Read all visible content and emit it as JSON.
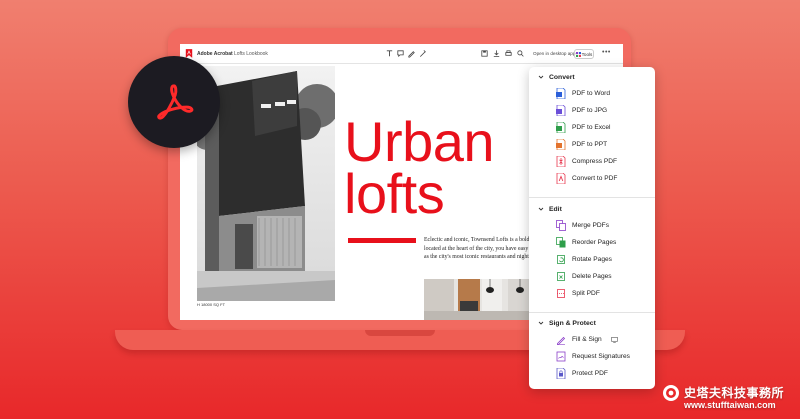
{
  "app": {
    "name": "Adobe Acrobat",
    "document_name": "Lofts Lookbook",
    "open_desktop_label": "Open in desktop app",
    "tools_label": "Tools",
    "more_label": "•••"
  },
  "document": {
    "headline_line1": "Urban",
    "headline_line2": "lofts",
    "body_text": "Eclectic and iconic, Townsend Lofts is a bold\nlocated at the heart of the city, you have easy\nas the city's most iconic restaurants and nightl",
    "photo_caption": "H 18000 SQ FT"
  },
  "menu": {
    "convert": {
      "title": "Convert",
      "items": [
        {
          "label": "PDF to Word",
          "icon": "word-icon",
          "color": "#2b5fd9"
        },
        {
          "label": "PDF to JPG",
          "icon": "jpg-icon",
          "color": "#6b4fd8"
        },
        {
          "label": "PDF to Excel",
          "icon": "excel-icon",
          "color": "#2e9e4a"
        },
        {
          "label": "PDF to PPT",
          "icon": "ppt-icon",
          "color": "#e3732d"
        },
        {
          "label": "Compress PDF",
          "icon": "compress-icon",
          "color": "#e8384f"
        },
        {
          "label": "Convert to PDF",
          "icon": "convert-icon",
          "color": "#e8384f"
        }
      ]
    },
    "edit": {
      "title": "Edit",
      "items": [
        {
          "label": "Merge PDFs",
          "icon": "merge-icon",
          "color": "#8a3ec9"
        },
        {
          "label": "Reorder Pages",
          "icon": "reorder-icon",
          "color": "#2e9e4a"
        },
        {
          "label": "Rotate Pages",
          "icon": "rotate-icon",
          "color": "#2e9e4a"
        },
        {
          "label": "Delete Pages",
          "icon": "delete-icon",
          "color": "#2e9e4a"
        },
        {
          "label": "Split PDF",
          "icon": "split-icon",
          "color": "#e8384f"
        }
      ]
    },
    "sign": {
      "title": "Sign & Protect",
      "items": [
        {
          "label": "Fill & Sign",
          "icon": "fill-sign-icon",
          "color": "#8a3ec9"
        },
        {
          "label": "Request Signatures",
          "icon": "request-signatures-icon",
          "color": "#8a3ec9"
        },
        {
          "label": "Protect PDF",
          "icon": "protect-icon",
          "color": "#5a58c8"
        }
      ]
    }
  },
  "watermark": {
    "title": "史塔夫科技事務所",
    "url": "www.stufftaiwan.com"
  },
  "colors": {
    "brand_red": "#e8101b",
    "badge_dark": "#1c1b22",
    "background_red": "#e8282a"
  }
}
